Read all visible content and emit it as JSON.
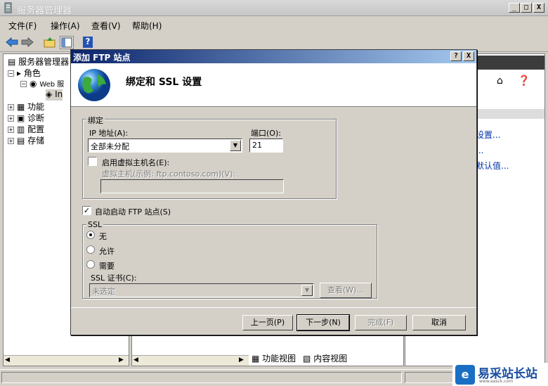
{
  "window": {
    "title": "服务器管理器",
    "min": "_",
    "max": "□",
    "close": "X"
  },
  "menu": [
    "文件(F)",
    "操作(A)",
    "查看(V)",
    "帮助(H)"
  ],
  "tree": {
    "root": "服务器管理器",
    "roles": "角色",
    "web": "Web 服",
    "iis": "In",
    "features": "功能",
    "diag": "诊断",
    "config": "配置",
    "storage": "存储"
  },
  "right": {
    "l1": "设置...",
    "l2": "...",
    "l3": "默认值..."
  },
  "mid": {
    "features_view": "功能视图",
    "content_view": "内容视图"
  },
  "dialog": {
    "title": "添加 FTP 站点",
    "help": "?",
    "close": "X",
    "heading": "绑定和 SSL 设置",
    "binding_group": "绑定",
    "ip_label": "IP 地址(A):",
    "ip_value": "全部未分配",
    "port_label": "端口(O):",
    "port_value": "21",
    "vhost_check_label": "启用虚拟主机名(E):",
    "vhost_label": "虚拟主机(示例: ftp.contoso.com)(V):",
    "autostart_label": "自动启动 FTP 站点(S)",
    "ssl_group": "SSL",
    "ssl_none": "无",
    "ssl_allow": "允许",
    "ssl_require": "需要",
    "cert_label": "SSL 证书(C):",
    "cert_value": "未选定",
    "view_btn": "查看(W)...",
    "prev_btn": "上一页(P)",
    "next_btn": "下一步(N)",
    "finish_btn": "完成(F)",
    "cancel_btn": "取消"
  },
  "watermark": {
    "text": "易采站长站",
    "sub": "www.easck.com"
  }
}
